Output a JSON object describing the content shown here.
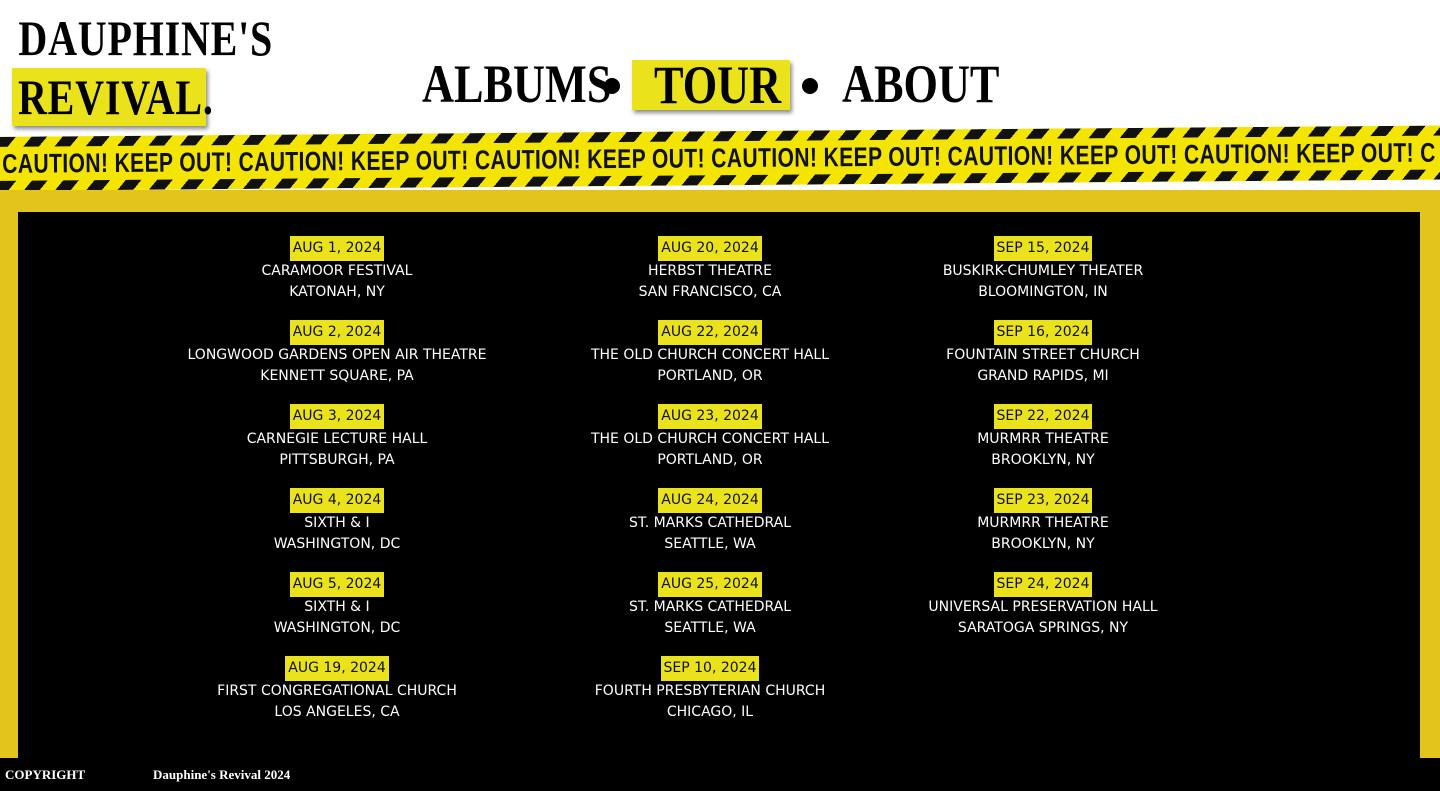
{
  "logo": {
    "line1": "DAUPHINE'S",
    "line2": "REVIVAL."
  },
  "nav": {
    "albums": "ALBUMS",
    "tour": "TOUR",
    "about": "ABOUT"
  },
  "tape": {
    "text": "CAUTION! KEEP OUT!  CAUTION! KEEP OUT!  CAUTION! KEEP OUT!  CAUTION! KEEP OUT!  CAUTION! KEEP OUT!  CAUTION! KEEP OUT!  C"
  },
  "colors": {
    "accent_yellow": "#eae21a",
    "frame_yellow": "#e3c41c",
    "panel_bg": "#000000",
    "text": "#ffffff"
  },
  "tour": {
    "columns": [
      [
        {
          "date": "AUG 1, 2024",
          "venue": "CARAMOOR FESTIVAL",
          "location": "KATONAH, NY"
        },
        {
          "date": "AUG 2, 2024",
          "venue": "LONGWOOD GARDENS OPEN AIR THEATRE",
          "location": "KENNETT SQUARE, PA"
        },
        {
          "date": "AUG 3, 2024",
          "venue": "CARNEGIE LECTURE HALL",
          "location": "PITTSBURGH, PA"
        },
        {
          "date": "AUG 4, 2024",
          "venue": "SIXTH & I",
          "location": "WASHINGTON, DC"
        },
        {
          "date": "AUG 5, 2024",
          "venue": "SIXTH & I",
          "location": "WASHINGTON, DC"
        },
        {
          "date": "AUG 19, 2024",
          "venue": "FIRST CONGREGATIONAL CHURCH",
          "location": "LOS ANGELES, CA"
        }
      ],
      [
        {
          "date": "AUG 20, 2024",
          "venue": "HERBST THEATRE",
          "location": "SAN FRANCISCO, CA"
        },
        {
          "date": "AUG 22, 2024",
          "venue": "THE OLD CHURCH CONCERT HALL",
          "location": "PORTLAND, OR"
        },
        {
          "date": "AUG 23, 2024",
          "venue": "THE OLD CHURCH CONCERT HALL",
          "location": "PORTLAND, OR"
        },
        {
          "date": "AUG 24, 2024",
          "venue": "ST. MARKS CATHEDRAL",
          "location": "SEATTLE, WA"
        },
        {
          "date": "AUG 25, 2024",
          "venue": "ST. MARKS CATHEDRAL",
          "location": "SEATTLE, WA"
        },
        {
          "date": "SEP 10, 2024",
          "venue": "FOURTH PRESBYTERIAN CHURCH",
          "location": "CHICAGO, IL"
        }
      ],
      [
        {
          "date": "SEP 15, 2024",
          "venue": "BUSKIRK-CHUMLEY THEATER",
          "location": "BLOOMINGTON, IN"
        },
        {
          "date": "SEP 16, 2024",
          "venue": "FOUNTAIN STREET CHURCH",
          "location": "GRAND RAPIDS, MI"
        },
        {
          "date": "SEP 22, 2024",
          "venue": "MURMRR THEATRE",
          "location": "BROOKLYN, NY"
        },
        {
          "date": "SEP 23, 2024",
          "venue": "MURMRR THEATRE",
          "location": "BROOKLYN, NY"
        },
        {
          "date": "SEP 24, 2024",
          "venue": "UNIVERSAL PRESERVATION HALL",
          "location": "SARATOGA SPRINGS, NY"
        }
      ]
    ]
  },
  "footer": {
    "copyright_label": "COPYRIGHT",
    "copyright_text": "Dauphine's Revival 2024"
  }
}
